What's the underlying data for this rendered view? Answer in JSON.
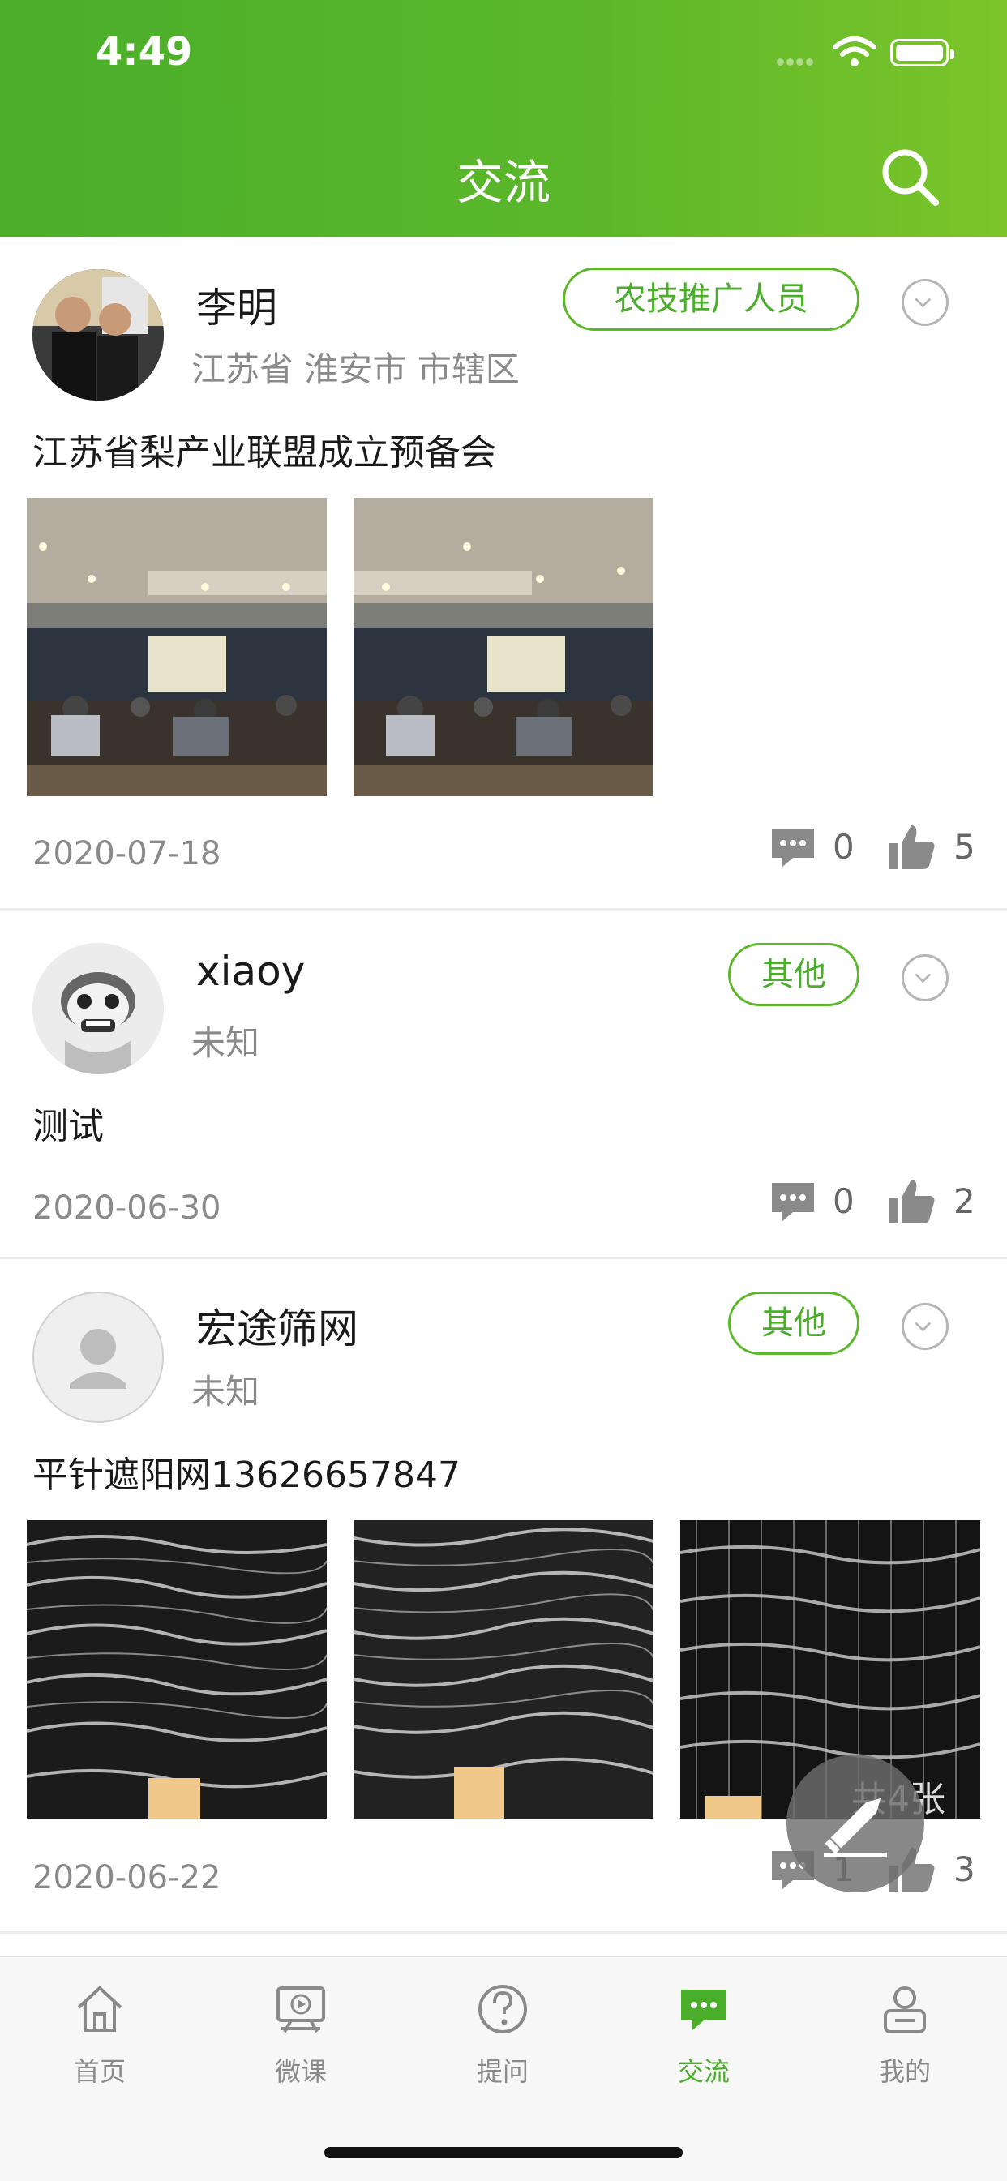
{
  "status": {
    "time": "4:49"
  },
  "header": {
    "title": "交流",
    "search_icon": "search-icon"
  },
  "posts": [
    {
      "username": "李明",
      "location": "江苏省 淮安市 市辖区",
      "tag": "农技推广人员",
      "text": "江苏省梨产业联盟成立预备会",
      "date": "2020-07-18",
      "comments": "0",
      "likes": "5",
      "image_count": 2
    },
    {
      "username": "xiaoy",
      "location": "未知",
      "tag": "其他",
      "text": "测试",
      "date": "2020-06-30",
      "comments": "0",
      "likes": "2",
      "image_count": 0
    },
    {
      "username": "宏途筛网",
      "location": "未知",
      "tag": "其他",
      "text": "平针遮阳网13626657847",
      "date": "2020-06-22",
      "comments": "1",
      "likes": "3",
      "image_count": 3,
      "overlay_text": "共4张"
    }
  ],
  "tabs": [
    {
      "label": "首页",
      "icon": "home-icon"
    },
    {
      "label": "微课",
      "icon": "video-lesson-icon"
    },
    {
      "label": "提问",
      "icon": "question-icon"
    },
    {
      "label": "交流",
      "icon": "chat-icon",
      "active": true
    },
    {
      "label": "我的",
      "icon": "profile-icon"
    }
  ],
  "fab": {
    "icon": "pencil-icon"
  },
  "colors": {
    "accent": "#4aae2b",
    "accent_light": "#7cc42a",
    "text_secondary": "#8a8a8a"
  }
}
